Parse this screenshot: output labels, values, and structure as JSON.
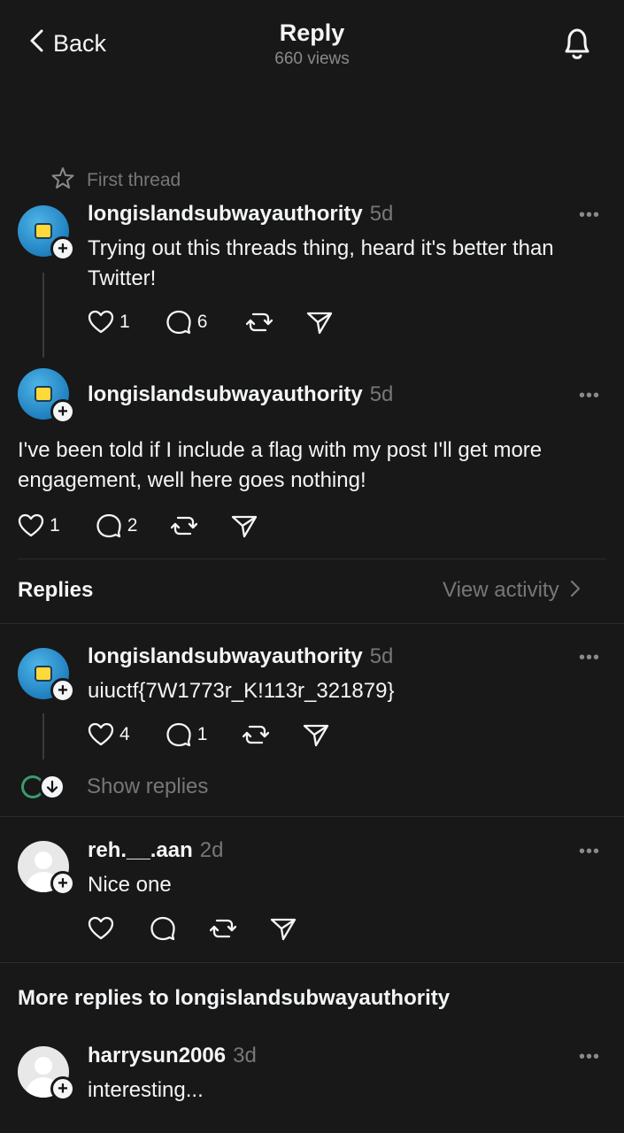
{
  "header": {
    "back_label": "Back",
    "title": "Reply",
    "views": "660 views"
  },
  "thread_label": "First thread",
  "post1": {
    "username": "longislandsubwayauthority",
    "time": "5d",
    "text": "Trying out this threads thing, heard it's better than Twitter!",
    "likes": "1",
    "replies": "6"
  },
  "post2": {
    "username": "longislandsubwayauthority",
    "time": "5d",
    "text": "I've been told if I include a flag with my post I'll get more engagement, well here goes nothing!",
    "likes": "1",
    "replies": "2"
  },
  "replies_section": {
    "title": "Replies",
    "view_activity": "View activity"
  },
  "reply1": {
    "username": "longislandsubwayauthority",
    "time": "5d",
    "text": "uiuctf{7W1773r_K!113r_321879}",
    "likes": "4",
    "replies": "1",
    "show_replies": "Show replies"
  },
  "reply2": {
    "username": "reh.__.aan",
    "time": "2d",
    "text": "Nice one"
  },
  "more_replies_title": "More replies to longislandsubwayauthority",
  "reply3": {
    "username": "harrysun2006",
    "time": "3d",
    "text": "interesting..."
  },
  "colors": {
    "background": "#181818",
    "text": "#f3f5f7",
    "muted": "#777777",
    "avatar_blue": "#2a8fd0"
  }
}
